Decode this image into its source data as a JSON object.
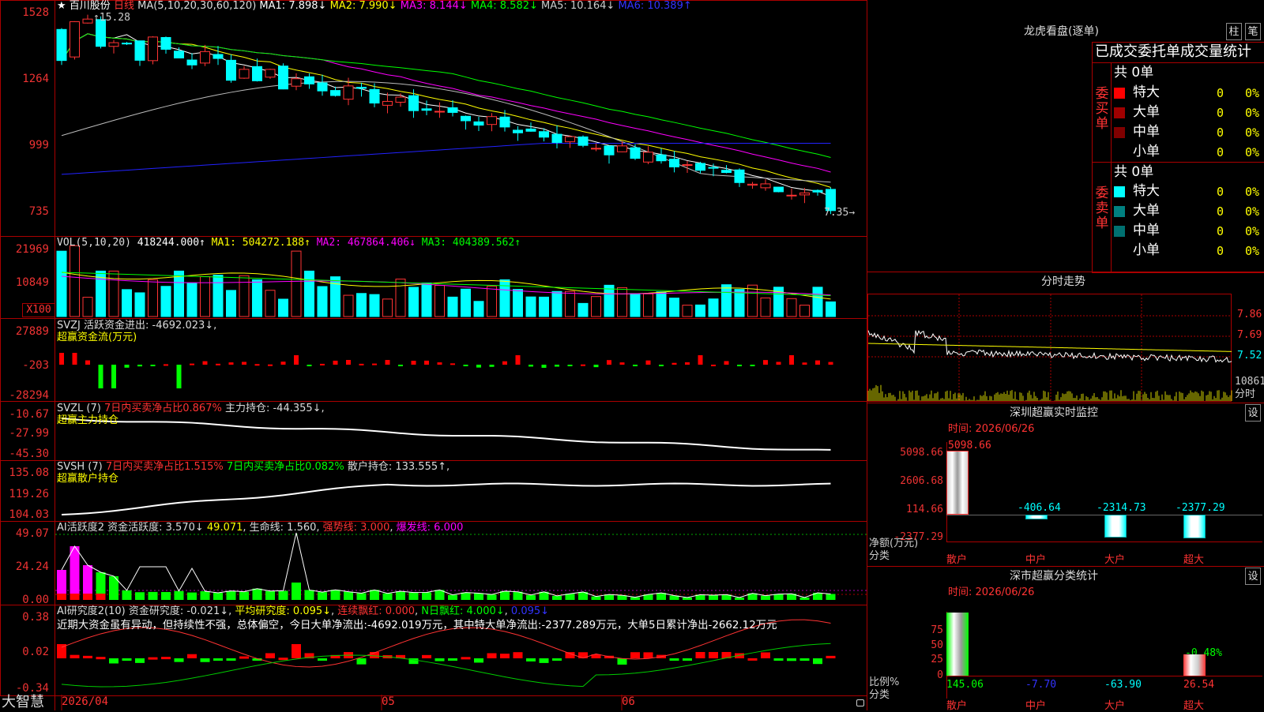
{
  "stock": {
    "star": "★",
    "name": "百川股份",
    "period": "日线"
  },
  "ma_header": {
    "label": "MA(5,10,20,30,60,120)",
    "ma1": "MA1: 7.898↓",
    "ma2": "MA2: 7.990↓",
    "ma3": "MA3: 8.144↓",
    "ma4": "MA4: 8.582↓",
    "ma5": "MA5: 10.164↓",
    "ma6": "MA6: 10.389↑"
  },
  "price_axis": {
    "labels": [
      "1528",
      "1264",
      "999",
      "735"
    ],
    "high_mark": "15.28",
    "low_mark": "7.35"
  },
  "vol_header": {
    "label": "VOL(5,10,20)",
    "value": "418244.000↑",
    "ma1": "MA1: 504272.188↑",
    "ma2": "MA2: 467864.406↓",
    "ma3": "MA3: 404389.562↑"
  },
  "vol_axis": {
    "labels": [
      "21969",
      "10849"
    ],
    "unit": "X100"
  },
  "svzj": {
    "label": "SVZJ",
    "text": "活跃资金进出: -4692.023↓,",
    "sub": "超赢资金流(万元)",
    "axis": [
      "27889",
      "-203",
      "-28294"
    ]
  },
  "svzl": {
    "label": "SVZL (7)",
    "red_text": "7日内买卖净占比0.867%",
    "text": "主力持仓: -44.355↓,",
    "sub": "超赢主力持仓",
    "axis": [
      "-10.67",
      "-27.99",
      "-45.30"
    ]
  },
  "svsh": {
    "label": "SVSH (7)",
    "red_text": "7日内买卖净占比1.515%",
    "green_text": "7日内买卖净占比0.082%",
    "text": "散户持仓: 133.555↑,",
    "sub": "超赢散户持仓",
    "axis": [
      "135.08",
      "119.26",
      "104.03"
    ]
  },
  "ai_active": {
    "label": "AI活跃度2",
    "t1": "资金活跃度: 3.570↓",
    "t2": "49.071",
    "t3": "生命线: 1.560",
    "t4": "强势线: 3.000",
    "t5": "爆发线: 6.000",
    "axis": [
      "49.07",
      "24.24",
      "0.00"
    ]
  },
  "ai_research": {
    "label": "AI研究度2(10)",
    "t1": "资金研究度: -0.021↓",
    "t2": "平均研究度: 0.095↓",
    "t3": "连续飘红: 0.000",
    "t4": "N日飘红: 4.000↓",
    "t5": "0.095↓",
    "comment": "近期大资金虽有异动，但持续性不强，总体偏空，今日大单净流出:-4692.019万元，其中特大单净流出:-2377.289万元，大单5日累计净出-2662.12万元",
    "axis": [
      "0.38",
      "0.02",
      "-0.34"
    ]
  },
  "footer": {
    "app": "大智慧",
    "dates": [
      "2026/04",
      "05",
      "06"
    ]
  },
  "lhb": {
    "title": "龙虎看盘(逐单)",
    "btn1": "柱",
    "btn2": "笔",
    "sub": "已成交委托单成交量统计",
    "buy_label": "委买单",
    "sell_label": "委卖单",
    "buy_total": "共 0单",
    "sell_total": "共 0单",
    "rows": [
      {
        "name": "特大",
        "count": "0",
        "pct": "0%",
        "buy_color": "#ff0000",
        "sell_color": "#00ffff"
      },
      {
        "name": "大单",
        "count": "0",
        "pct": "0%",
        "buy_color": "#a00000",
        "sell_color": "#008080"
      },
      {
        "name": "中单",
        "count": "0",
        "pct": "0%",
        "buy_color": "#800000",
        "sell_color": "#007070"
      },
      {
        "name": "小单",
        "count": "0",
        "pct": "0%",
        "buy_color": "",
        "sell_color": ""
      }
    ]
  },
  "intraday": {
    "title": "分时走势",
    "axis": [
      "7.86",
      "7.69",
      "7.52"
    ],
    "vol": "10861",
    "vol_unit": "分时"
  },
  "monitor": {
    "title": "深圳超赢实时监控",
    "btn": "设",
    "time": "时间: 2026/06/26",
    "top_val": "5098.66",
    "axis": [
      "5098.66",
      "2606.68",
      "114.66",
      "-2377.29"
    ],
    "ylabel": "净额(万元)",
    "xlabel": "分类",
    "cats": [
      "散户",
      "中户",
      "大户",
      "超大"
    ],
    "vals": [
      "5098.66",
      "-406.64",
      "-2314.73",
      "-2377.29"
    ]
  },
  "classify": {
    "title": "深市超赢分类统计",
    "btn": "设",
    "time": "时间: 2026/06/26",
    "axis": [
      "75",
      "50",
      "25",
      "0"
    ],
    "ylabel": "比例%",
    "xlabel": "分类",
    "top_val": "-0.48%",
    "cats": [
      "散户",
      "中户",
      "大户",
      "超大"
    ],
    "vals": [
      "145.06",
      "-7.70",
      "-63.90",
      "26.54"
    ]
  },
  "chart_data": [
    {
      "type": "candlestick",
      "title": "百川股份 日线",
      "x_ticks": [
        "2026/04",
        "05",
        "06"
      ],
      "ylim": [
        7.35,
        15.28
      ],
      "ohlc_approx": [
        [
          14.6,
          15.28,
          13.2,
          13.4
        ],
        [
          13.8,
          15.0,
          13.5,
          14.9
        ],
        [
          14.9,
          15.2,
          14.6,
          15.0
        ],
        [
          14.8,
          15.0,
          14.2,
          14.4
        ],
        [
          14.3,
          14.5,
          13.3,
          13.5
        ],
        [
          13.4,
          13.6,
          12.6,
          12.8
        ],
        [
          12.7,
          13.4,
          12.5,
          13.3
        ],
        [
          13.2,
          13.8,
          12.8,
          13.0
        ],
        [
          13.6,
          14.5,
          13.3,
          13.5
        ]
      ],
      "ma_last": {
        "MA1": 7.898,
        "MA2": 7.99,
        "MA3": 8.144,
        "MA4": 8.582,
        "MA5": 10.164,
        "MA6": 10.389
      }
    },
    {
      "type": "bar",
      "title": "VOL(5,10,20)",
      "last": 418244.0,
      "ma": {
        "MA1": 504272.188,
        "MA2": 467864.406,
        "MA3": 404389.562
      },
      "ylim": [
        0,
        21969
      ]
    },
    {
      "type": "bar",
      "title": "超赢资金流(万元)",
      "last": -4692.023,
      "ylim": [
        -28294,
        27889
      ]
    },
    {
      "type": "line",
      "title": "超赢主力持仓",
      "last": -44.355,
      "ylim": [
        -45.3,
        -10.67
      ]
    },
    {
      "type": "line",
      "title": "超赢散户持仓",
      "last": 133.555,
      "ylim": [
        104.03,
        135.08
      ]
    },
    {
      "type": "bar",
      "title": "AI活跃度2",
      "last": 3.57,
      "peak": 49.071,
      "lines": {
        "生命线": 1.56,
        "强势线": 3.0,
        "爆发线": 6.0
      },
      "ylim": [
        0,
        49.07
      ]
    },
    {
      "type": "bar",
      "title": "AI研究度2(10)",
      "last": -0.021,
      "avg": 0.095,
      "ylim": [
        -0.34,
        0.38
      ]
    },
    {
      "type": "line",
      "title": "分时走势",
      "axis": [
        7.86,
        7.69,
        7.52
      ]
    },
    {
      "type": "bar",
      "title": "深圳超赢实时监控",
      "categories": [
        "散户",
        "中户",
        "大户",
        "超大"
      ],
      "values": [
        5098.66,
        -406.64,
        -2314.73,
        -2377.29
      ],
      "ylim": [
        -2377.29,
        5098.66
      ]
    },
    {
      "type": "bar",
      "title": "深市超赢分类统计",
      "categories": [
        "散户",
        "中户",
        "大户",
        "超大"
      ],
      "values": [
        145.06,
        -7.7,
        -63.9,
        26.54
      ],
      "ylim": [
        0,
        75
      ]
    }
  ]
}
